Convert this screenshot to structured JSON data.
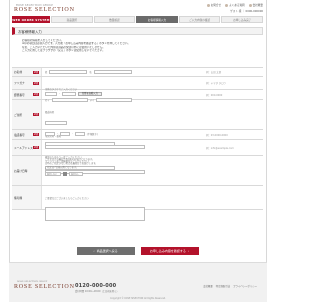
{
  "brand": {
    "small": "ROSE SELECTION GROUP",
    "name": "ROSE SELECTION"
  },
  "top_links": [
    "お問合せ",
    "よくある質問",
    "会社概要"
  ],
  "user_line": "ゲスト 様 ｜ 0000-000000",
  "steps": {
    "brand_label": "WEB ORDER SYSTEM",
    "items": [
      "商品選択",
      "数量確認",
      "お客様情報入力",
      "ご入力内容の確認",
      "お申し込み完了"
    ],
    "active_index": 2
  },
  "page_title": "お客様情報入力",
  "intro": [
    "お客様の情報を入力してください。",
    "※印の項目は必須入力です。入力後「お申し込み内容を確認する」ボタンを押してください。",
    "なお、ご入力いただいた内容は商品の発送以外には使用いたしません。",
    "ご入力に際してはブラウザの「戻る」ボタンは使用しないでください。"
  ],
  "required_label": "必須",
  "form": {
    "name": {
      "label": "お名前",
      "sei": "姓",
      "mei": "名",
      "note": "例：山田 太郎"
    },
    "kana": {
      "label": "フリガナ",
      "sei": "セイ",
      "mei": "メイ",
      "hint": "全角カタカナでご入力ください",
      "note": "例：ヤマダ タロウ"
    },
    "zip": {
      "label": "郵便番号",
      "button": "住所を自動入力",
      "note": "例：000-0000"
    },
    "address": {
      "label": "ご住所",
      "pref_label": "都道府県",
      "city_label": "市区町村・番地",
      "building_hint": "マンション名・部屋番号もご入力ください",
      "note": ""
    },
    "phone": {
      "label": "電話番号",
      "hint": "(半角数字)",
      "note": "例：03-0000-0000"
    },
    "email": {
      "label": "メールアドレス",
      "confirm_hint": "確認のためもう一度ご入力ください",
      "note": "例：info@example.com"
    },
    "delivery": {
      "label": "お届け日時",
      "lines": [
        "ご注文日から最短で3日後のお届けとなります。",
        "日時のご指定がない場合は最短日でお届けします。",
        "ご指定は7日後以降となります。"
      ],
      "date_value": "指定しない",
      "time_value": "指定なし"
    },
    "remarks": {
      "label": "備考欄",
      "hint": "ご要望などございましたらご入力ください"
    }
  },
  "buttons": {
    "back": "商品選択へ戻る",
    "next": "お申し込み内容を確認する"
  },
  "footer": {
    "brand_small": "ROSE SELECTION GROUP",
    "brand_name": "ROSE SELECTION",
    "phone": "0120-000-000",
    "phone_note": "受付時間 10:00〜18:00（土日祝を除く）",
    "links": [
      "会社概要",
      "特定商取引法",
      "プライバシーポリシー"
    ],
    "copyright": "Copyright © ROSE SELECTION All Rights Reserved."
  }
}
